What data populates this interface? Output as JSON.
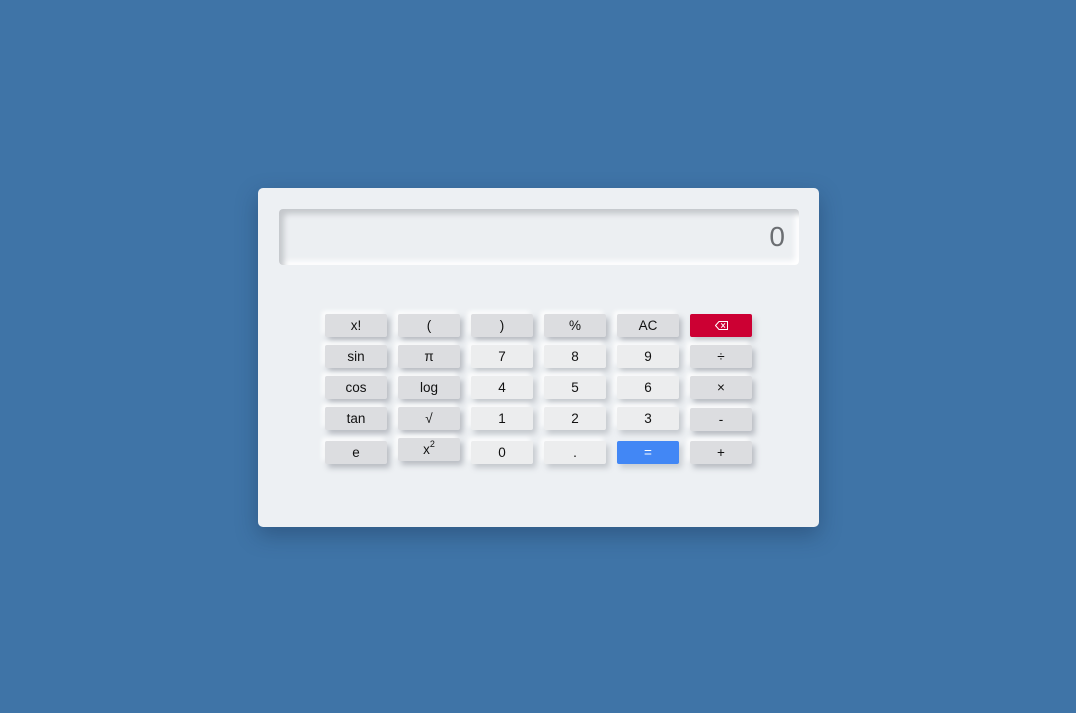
{
  "display": {
    "value": "0"
  },
  "buttons": {
    "factorial": "x!",
    "open_paren": "(",
    "close_paren": ")",
    "percent": "%",
    "clear": "AC",
    "sin": "sin",
    "pi": "π",
    "seven": "7",
    "eight": "8",
    "nine": "9",
    "divide": "÷",
    "cos": "cos",
    "log": "log",
    "four": "4",
    "five": "5",
    "six": "6",
    "multiply": "×",
    "tan": "tan",
    "sqrt": "√",
    "one": "1",
    "two": "2",
    "three": "3",
    "minus": "-",
    "e": "e",
    "square_base": "x",
    "square_exp": "2",
    "zero": "0",
    "decimal": ".",
    "equals": "=",
    "plus": "+"
  },
  "icons": {
    "delete": "backspace-icon"
  },
  "colors": {
    "background": "#3f74a7",
    "panel": "#edf0f3",
    "delete": "#cc0033",
    "equals": "#4287f5"
  }
}
